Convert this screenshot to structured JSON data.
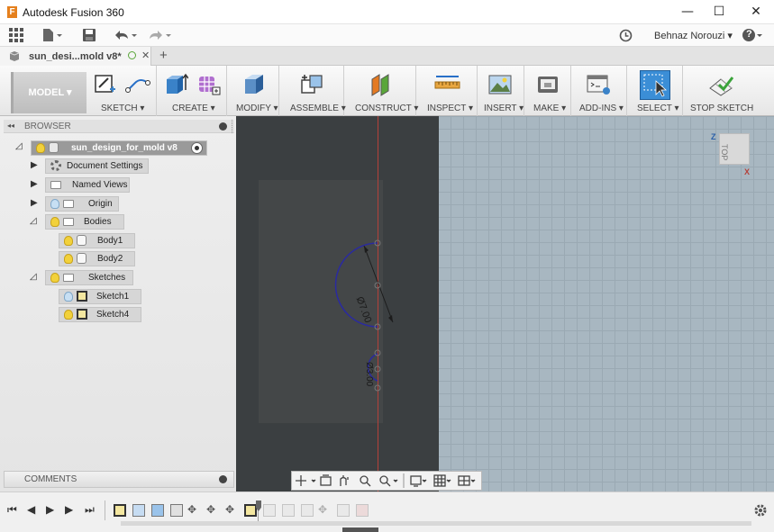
{
  "window": {
    "title": "Autodesk Fusion 360",
    "logo_letter": "F",
    "minimize": "—",
    "maximize": "☐",
    "close": "✕"
  },
  "user": {
    "name": "Behnaz Norouzi ▾",
    "help": "?"
  },
  "document_tab": {
    "label": "sun_desi...mold v8*",
    "close": "✕",
    "add": "+"
  },
  "toolbar": {
    "workspace": "MODEL ▾",
    "groups": [
      "SKETCH ▾",
      "CREATE ▾",
      "MODIFY ▾",
      "ASSEMBLE ▾",
      "CONSTRUCT ▾",
      "INSPECT ▾",
      "INSERT ▾",
      "MAKE ▾",
      "ADD-INS ▾",
      "SELECT ▾",
      "STOP SKETCH"
    ]
  },
  "browser": {
    "title": "BROWSER",
    "collapse": "◂◂",
    "root": "sun_design_for_mold v8",
    "items": [
      "Document Settings",
      "Named Views",
      "Origin",
      "Bodies",
      "Body1",
      "Body2",
      "Sketches",
      "Sketch1",
      "Sketch4"
    ]
  },
  "comments": {
    "title": "COMMENTS"
  },
  "canvas": {
    "dim_large": "Ø7.00",
    "dim_small": "Ø3.00",
    "viewcube_face": "TOP",
    "axis_z": "Z",
    "axis_x": "X"
  },
  "colors": {
    "canvas_bg": "#a8b7c1",
    "dark_region": "#3b3f41",
    "arc": "#2a2aa0",
    "select_active": "#3b8ed6"
  },
  "icons": [
    "grid-icon",
    "file-icon",
    "save-icon",
    "undo-icon",
    "redo-icon",
    "clock-icon",
    "help-icon",
    "play-icon",
    "gear-icon"
  ]
}
